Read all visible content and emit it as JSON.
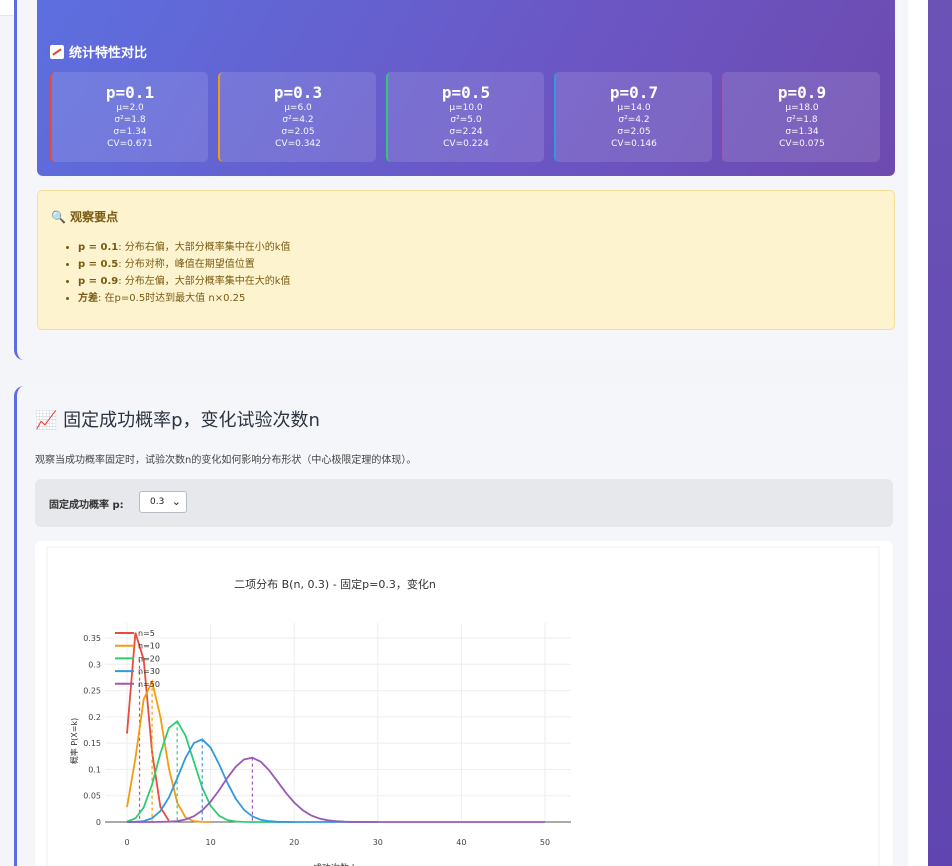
{
  "section1": {
    "stats_title": "统计特性对比",
    "cards": [
      {
        "p": "p=0.1",
        "mu": "μ=2.0",
        "var": "σ²=1.8",
        "sd": "σ=1.34",
        "cv": "CV=0.671",
        "color": "#e74c3c"
      },
      {
        "p": "p=0.3",
        "mu": "μ=6.0",
        "var": "σ²=4.2",
        "sd": "σ=2.05",
        "cv": "CV=0.342",
        "color": "#f39c12"
      },
      {
        "p": "p=0.5",
        "mu": "μ=10.0",
        "var": "σ²=5.0",
        "sd": "σ=2.24",
        "cv": "CV=0.224",
        "color": "#2ecc71"
      },
      {
        "p": "p=0.7",
        "mu": "μ=14.0",
        "var": "σ²=4.2",
        "sd": "σ=2.05",
        "cv": "CV=0.146",
        "color": "#3498db"
      },
      {
        "p": "p=0.9",
        "mu": "μ=18.0",
        "var": "σ²=1.8",
        "sd": "σ=1.34",
        "cv": "CV=0.075",
        "color": "#9b59b6"
      }
    ],
    "obs_title": "观察要点",
    "obs_items": [
      {
        "key": "p = 0.1",
        "text": ": 分布右偏，大部分概率集中在小的k值"
      },
      {
        "key": "p = 0.5",
        "text": ": 分布对称，峰值在期望值位置"
      },
      {
        "key": "p = 0.9",
        "text": ": 分布左偏，大部分概率集中在大的k值"
      },
      {
        "key": "方差",
        "text": ": 在p=0.5时达到最大值 n×0.25"
      }
    ]
  },
  "section2": {
    "title": "📈 固定成功概率p，变化试验次数n",
    "desc": "观察当成功概率固定时，试验次数n的变化如何影响分布形状（中心极限定理的体现）。",
    "control_label": "固定成功概率 p:",
    "select_value": "0.3"
  },
  "chart_data": {
    "type": "line",
    "title": "二项分布 B(n, 0.3) - 固定p=0.3，变化n",
    "xlabel": "成功次数 k",
    "ylabel": "概率 P(X=k)",
    "xlim": [
      -5,
      53
    ],
    "ylim": [
      -0.01,
      0.37
    ],
    "x_ticks": [
      0,
      10,
      20,
      30,
      40,
      50
    ],
    "y_ticks": [
      0,
      0.05,
      0.1,
      0.15,
      0.2,
      0.25,
      0.3,
      0.35
    ],
    "y_tick_labels": [
      "0",
      "0.05",
      "0.1",
      "0.15",
      "0.2",
      "0.25",
      "0.3",
      "0.35"
    ],
    "grid": true,
    "legend": "top-left",
    "p": 0.3,
    "series": [
      {
        "name": "n=5",
        "n": 5,
        "color": "#e74c3c"
      },
      {
        "name": "n=10",
        "n": 10,
        "color": "#f39c12"
      },
      {
        "name": "n=20",
        "n": 20,
        "color": "#2ecc71"
      },
      {
        "name": "n=30",
        "n": 30,
        "color": "#3498db"
      },
      {
        "name": "n=50",
        "n": 50,
        "color": "#9b59b6"
      }
    ]
  }
}
